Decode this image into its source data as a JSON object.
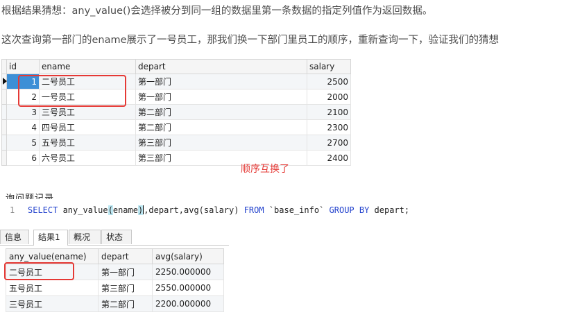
{
  "paragraphs": {
    "p1": "根据结果猜想：any_value()会选择被分到同一组的数据里第一条数据的指定列值作为返回数据。",
    "p2": "这次查询第一部门的ename展示了一号员工，那我们换一下部门里员工的顺序，重新查询一下，验证我们的猜想"
  },
  "table1": {
    "columns": [
      "id",
      "ename",
      "depart",
      "salary"
    ],
    "rows": [
      [
        "1",
        "二号员工",
        "第一部门",
        "2500"
      ],
      [
        "2",
        "一号员工",
        "第一部门",
        "2000"
      ],
      [
        "3",
        "三号员工",
        "第二部门",
        "2100"
      ],
      [
        "4",
        "四号员工",
        "第二部门",
        "2300"
      ],
      [
        "5",
        "五号员工",
        "第三部门",
        "2700"
      ],
      [
        "6",
        "六号员工",
        "第三部门",
        "2400"
      ]
    ]
  },
  "annotation": "顺序互换了",
  "editor": {
    "title_fragment": "询问题记录",
    "line_number": "1",
    "sql": {
      "select": "SELECT",
      "fn": " any_value",
      "open": "(",
      "arg": "ename",
      "close": ")",
      "rest1": ",depart,avg(salary) ",
      "from": "FROM",
      "table": " `base_info` ",
      "group_by": "GROUP BY",
      "rest2": " depart;"
    }
  },
  "tabs": [
    "信息",
    "结果1",
    "概况",
    "状态"
  ],
  "table2": {
    "columns": [
      "any_value(ename)",
      "depart",
      "avg(salary)"
    ],
    "rows": [
      [
        "二号员工",
        "第一部门",
        "2250.000000"
      ],
      [
        "五号员工",
        "第三部门",
        "2550.000000"
      ],
      [
        "三号员工",
        "第二部门",
        "2200.000000"
      ]
    ]
  },
  "colors": {
    "highlight_box": "#e53935",
    "keyword": "#1f3fcc",
    "selected_cell": "#3d8fd6"
  }
}
